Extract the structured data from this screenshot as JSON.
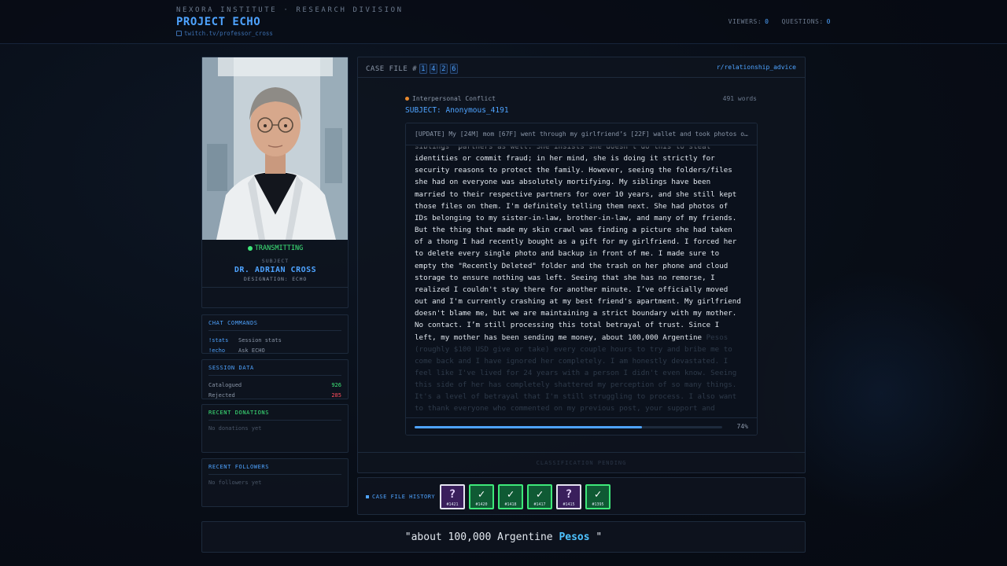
{
  "header": {
    "org": "NEXORA INSTITUTE · RESEARCH DIVISION",
    "project": "PROJECT ECHO",
    "channel": "twitch.tv/professor_cross",
    "viewers_label": "VIEWERS:",
    "viewers_value": "0",
    "questions_label": "QUESTIONS:",
    "questions_value": "0"
  },
  "subject_card": {
    "status": "TRANSMITTING",
    "label": "SUBJECT",
    "name": "DR. ADRIAN CROSS",
    "designation": "DESIGNATION: ECHO"
  },
  "chat_commands": {
    "title": "CHAT COMMANDS",
    "items": [
      {
        "command": "!stats",
        "desc": "Session stats"
      },
      {
        "command": "!echo",
        "desc": "Ask ECHO"
      }
    ]
  },
  "session_data": {
    "title": "SESSION DATA",
    "catalogued_label": "Catalogued",
    "catalogued_value": "926",
    "rejected_label": "Rejected",
    "rejected_value": "285"
  },
  "donations": {
    "title": "RECENT DONATIONS",
    "empty": "No donations yet"
  },
  "followers": {
    "title": "RECENT FOLLOWERS",
    "empty": "No followers yet"
  },
  "case": {
    "label": "CASE FILE #",
    "digits": [
      "1",
      "4",
      "2",
      "6"
    ],
    "subreddit": "r/relationship_advice",
    "category": "Interpersonal Conflict",
    "category_color": "#e88a2e",
    "word_count": "491 words",
    "subject": "SUBJECT: Anonymous_4191",
    "post_title": "[UPDATE] My [24M] mom [67F] went through my girlfriend’s [22F] wallet and took photos o…",
    "lines": [
      "siblings' partners as well. She insists she doesn't do this to steal",
      "identities or commit fraud; in her mind, she is doing it strictly for",
      "security reasons to protect the family. However, seeing the folders/files",
      "she had on everyone was absolutely mortifying. My siblings have been",
      "married to their respective partners for over 10 years, and she still kept",
      "those files on them. I'm definitely telling them next. She had photos of",
      "IDs belonging to my sister-in-law, brother-in-law, and many of my friends.",
      "But the thing that made my skin crawl was finding a picture she had taken",
      "of a thong I had recently bought as a gift for my girlfriend. I forced her",
      "to delete every single photo and backup in front of me. I made sure to",
      "empty the \"Recently Deleted\" folder and the trash on her phone and cloud",
      "storage to ensure nothing was left. Seeing that she has no remorse, I",
      "realized I couldn't stay there for another minute. I’ve officially moved",
      "out and I'm currently crashing at my best friend's apartment. My girlfriend",
      "doesn't blame me, but we are maintaining a strict boundary with my mother.",
      "No contact. I’m still processing this total betrayal of trust. Since I",
      "left, my mother has been sending me money, about 100,000 Argentine"
    ],
    "line_tail": " Pesos",
    "faded_lines": [
      "(roughly $100 USD give or take) every couple hours to try and bribe me to",
      "come back and I have ignored her completely. I am honestly devastated. I",
      "feel like I've lived for 24 years with a person I didn't even know. Seeing",
      "this side of her has completely shattered my perception of so many things.",
      "It's a level of betrayal that I'm still struggling to process. I also want",
      "to thank everyone who commented on my previous post, your support and"
    ],
    "progress_pct": 74,
    "progress_label": "74%",
    "classification": "CLASSIFICATION PENDING"
  },
  "history": {
    "label": "CASE FILE HISTORY",
    "cards": [
      {
        "symbol": "?",
        "id": "#1421",
        "state": "unknown"
      },
      {
        "symbol": "✓",
        "id": "#1420",
        "state": "ok"
      },
      {
        "symbol": "✓",
        "id": "#1418",
        "state": "ok"
      },
      {
        "symbol": "✓",
        "id": "#1417",
        "state": "ok"
      },
      {
        "symbol": "?",
        "id": "#1415",
        "state": "unknown"
      },
      {
        "symbol": "✓",
        "id": "#1395",
        "state": "ok"
      }
    ]
  },
  "quote": {
    "prefix": "\"about 100,000 Argentine ",
    "highlight": "Pesos",
    "suffix": " \""
  },
  "colors": {
    "accent": "#4ea3ff",
    "success": "#3ee87a",
    "danger": "#ff4d5e"
  }
}
